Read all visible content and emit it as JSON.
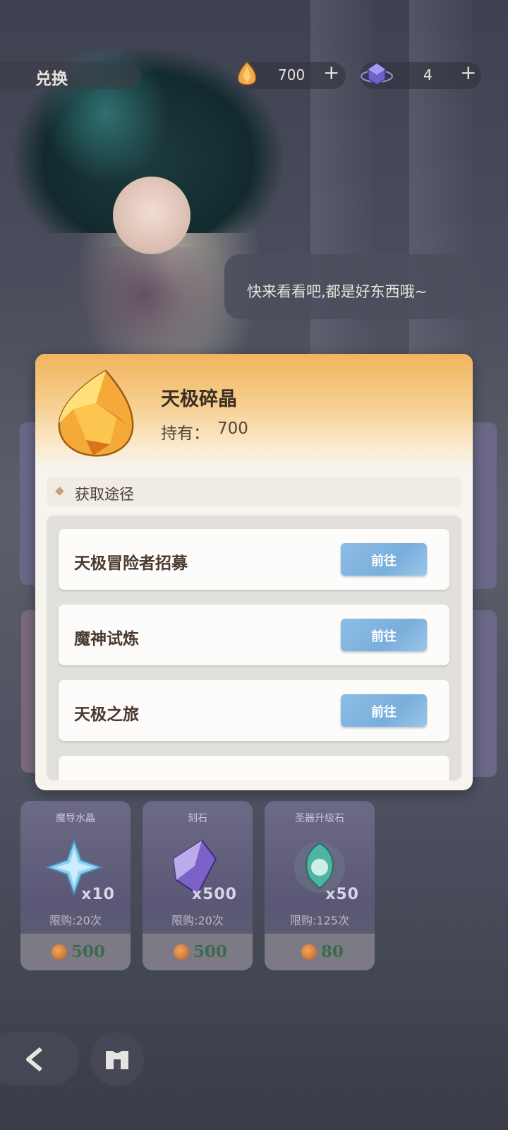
{
  "header": {
    "title": "兑换",
    "currencies": [
      {
        "icon": "fire-crystal-icon",
        "value": "700",
        "plus": "+"
      },
      {
        "icon": "purple-cube-icon",
        "value": "4",
        "plus": "+"
      }
    ]
  },
  "npc": {
    "speech": "快来看看吧,都是好东西哦~"
  },
  "shop_items": [
    {
      "name": "魔导水晶",
      "icon": "blue-crystal-icon",
      "qty": "x10",
      "limit": "限购:20次",
      "price": "500"
    },
    {
      "name": "刻石",
      "icon": "purple-stone-icon",
      "qty": "x500",
      "limit": "限购:20次",
      "price": "500"
    },
    {
      "name": "圣器升级石",
      "icon": "green-relic-stone-icon",
      "qty": "x50",
      "limit": "限购:125次",
      "price": "80"
    }
  ],
  "modal": {
    "item_name": "天极碎晶",
    "held_label": "持有：",
    "held_value": "700",
    "section_title": "获取途径",
    "sources": [
      {
        "label": "天极冒险者招募",
        "button": "前往"
      },
      {
        "label": "魔神试炼",
        "button": "前往"
      },
      {
        "label": "天极之旅",
        "button": "前往"
      }
    ]
  },
  "colors": {
    "modal_header_top": "#f1b45c",
    "go_button": "#7aaedb",
    "price_green": "#3c6a4e"
  }
}
